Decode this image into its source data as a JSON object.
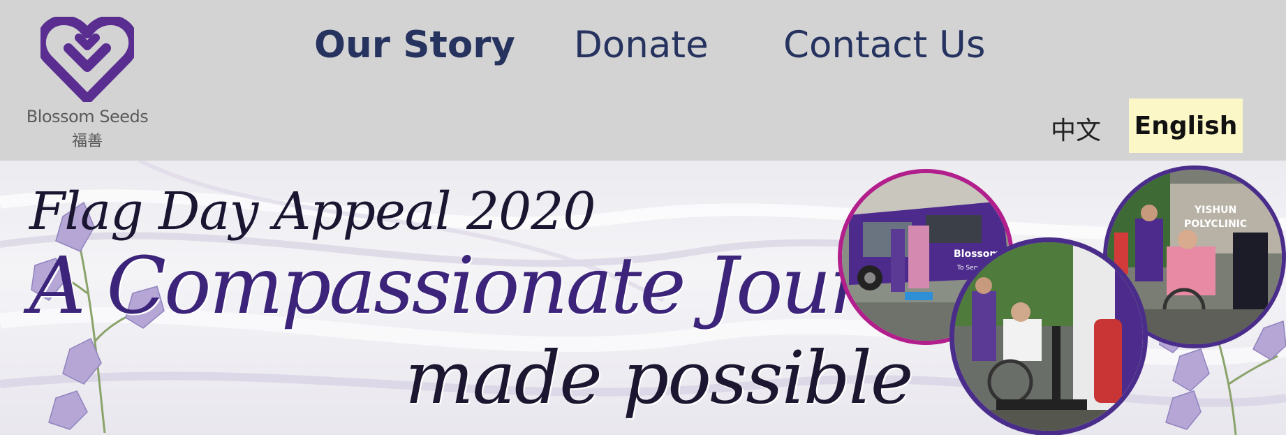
{
  "logo": {
    "name": "Blossom Seeds",
    "name_cn": "福善",
    "color": "#5a2d91"
  },
  "nav": {
    "items": [
      {
        "label": "Our Story",
        "active": true
      },
      {
        "label": "Donate",
        "active": false
      },
      {
        "label": "Contact Us",
        "active": false
      }
    ],
    "color": "#26335f"
  },
  "language": {
    "chinese_label": "中文",
    "english_label": "English",
    "selected": "English"
  },
  "banner": {
    "flag_title": "Flag Day Appeal 2020",
    "main_title": "A Compassionate Journey",
    "sub_title": "made possible",
    "photo1_van_text": "Blossom",
    "photo1_van_tagline": "To Serve",
    "photo3_sign_line1": "YISHUN",
    "photo3_sign_line2": "POLYCLINIC",
    "colors": {
      "title_purple": "#3b2479",
      "photo_border_magenta": "#b21e8c",
      "photo_border_purple": "#4a2d8a"
    }
  }
}
